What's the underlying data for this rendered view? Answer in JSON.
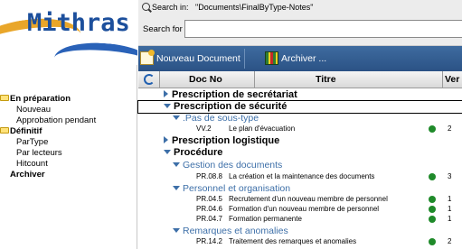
{
  "app": {
    "logo_text": "Mithras"
  },
  "sidebar": {
    "items": [
      {
        "label": "En préparation",
        "bold": true,
        "folder": true
      },
      {
        "label": "Nouveau"
      },
      {
        "label": "Approbation pendant"
      },
      {
        "label": "Définitif",
        "bold": true,
        "folder": true
      },
      {
        "label": "ParType"
      },
      {
        "label": "Par lecteurs"
      },
      {
        "label": "Hitcount"
      },
      {
        "label": "Archiver",
        "bold": true
      }
    ]
  },
  "search": {
    "label": "Search in:",
    "path": "\"Documents\\FinalByType-Notes\"",
    "for_label": "Search for",
    "value": ""
  },
  "toolbar": {
    "new_label": "Nouveau Document",
    "archive_label": "Archiver ..."
  },
  "columns": {
    "doc_no": "Doc No",
    "title": "Titre",
    "version": "Ver"
  },
  "rows": [
    {
      "kind": "cat",
      "label": "Prescription de secrétariat"
    },
    {
      "kind": "cat",
      "label": "Prescription de sécurité"
    },
    {
      "kind": "sub",
      "label": ".Pas de sous-type"
    },
    {
      "kind": "doc",
      "no": "VV.2",
      "title": "Le plan d'évacuation",
      "ver": "2"
    },
    {
      "kind": "cat",
      "label": "Prescription logistique"
    },
    {
      "kind": "cat",
      "label": "Procédure"
    },
    {
      "kind": "sub",
      "label": "Gestion des documents"
    },
    {
      "kind": "doc",
      "no": "PR.08.8",
      "title": "La création et la maintenance des documents",
      "ver": "3"
    },
    {
      "kind": "sub",
      "label": "Personnel et organisation"
    },
    {
      "kind": "doc",
      "no": "PR.04.5",
      "title": "Recrutement d'un nouveau membre de personnel",
      "ver": "1"
    },
    {
      "kind": "doc",
      "no": "PR.04.6",
      "title": "Formation d'un nouveau membre de personnel",
      "ver": "1"
    },
    {
      "kind": "doc",
      "no": "PR.04.7",
      "title": "Formation permanente",
      "ver": "1"
    },
    {
      "kind": "sub",
      "label": "Remarques et anomalies"
    },
    {
      "kind": "doc",
      "no": "PR.14.2",
      "title": "Traitement des remarques et anomalies",
      "ver": "2"
    }
  ],
  "colors": {
    "accent": "#3d6fa8",
    "toolbar": "#2b5285",
    "status_ok": "#1f8a2a",
    "folder": "#ffe27a"
  },
  "icons": [
    "search-icon",
    "new-document-icon",
    "archive-icon",
    "refresh-icon",
    "folder-icon",
    "expand-arrow-icon",
    "collapse-arrow-icon",
    "status-dot-icon"
  ]
}
